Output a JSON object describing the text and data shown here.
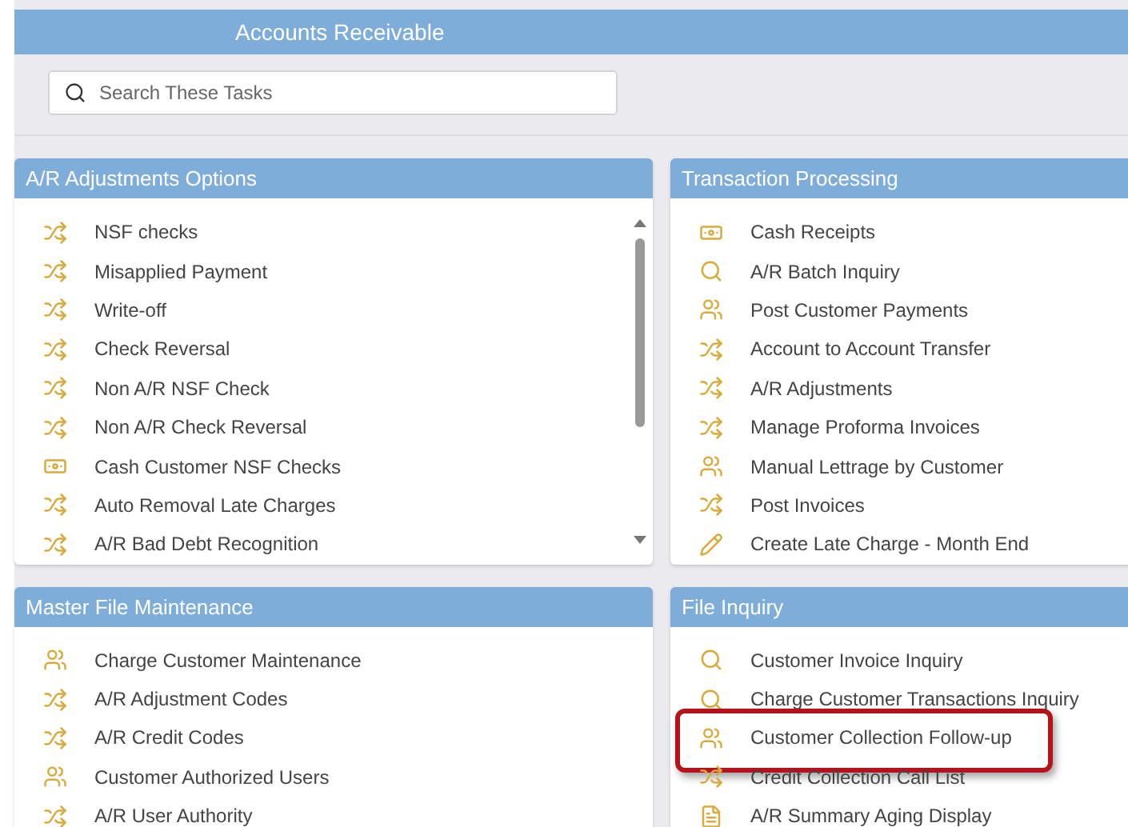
{
  "header": {
    "title": "Accounts Receivable"
  },
  "search": {
    "placeholder": "Search These Tasks"
  },
  "panels": [
    {
      "title": "A/R Adjustments Options",
      "scrollable": true,
      "items": [
        {
          "label": "NSF checks",
          "kind": "shuffle",
          "highlighted": false
        },
        {
          "label": "Misapplied Payment",
          "kind": "shuffle",
          "highlighted": false
        },
        {
          "label": "Write-off",
          "kind": "shuffle",
          "highlighted": false
        },
        {
          "label": "Check Reversal",
          "kind": "shuffle",
          "highlighted": false
        },
        {
          "label": "Non A/R NSF Check",
          "kind": "shuffle",
          "highlighted": false
        },
        {
          "label": "Non A/R Check Reversal",
          "kind": "shuffle",
          "highlighted": false
        },
        {
          "label": "Cash Customer NSF Checks",
          "kind": "cash",
          "highlighted": false
        },
        {
          "label": "Auto Removal Late Charges",
          "kind": "shuffle",
          "highlighted": false
        },
        {
          "label": "A/R Bad Debt Recognition",
          "kind": "shuffle",
          "highlighted": false
        }
      ]
    },
    {
      "title": "Transaction Processing",
      "scrollable": false,
      "items": [
        {
          "label": "Cash Receipts",
          "kind": "cash",
          "highlighted": false
        },
        {
          "label": "A/R Batch Inquiry",
          "kind": "search",
          "highlighted": false
        },
        {
          "label": "Post Customer Payments",
          "kind": "users",
          "highlighted": false
        },
        {
          "label": "Account to Account Transfer",
          "kind": "shuffle",
          "highlighted": false
        },
        {
          "label": "A/R Adjustments",
          "kind": "shuffle",
          "highlighted": false
        },
        {
          "label": "Manage Proforma Invoices",
          "kind": "shuffle",
          "highlighted": false
        },
        {
          "label": "Manual Lettrage by Customer",
          "kind": "users",
          "highlighted": false
        },
        {
          "label": "Post Invoices",
          "kind": "shuffle",
          "highlighted": false
        },
        {
          "label": "Create Late Charge - Month End",
          "kind": "pencil",
          "highlighted": false
        }
      ]
    },
    {
      "title": "Master File Maintenance",
      "scrollable": false,
      "items": [
        {
          "label": "Charge Customer Maintenance",
          "kind": "users",
          "highlighted": false
        },
        {
          "label": "A/R Adjustment Codes",
          "kind": "shuffle",
          "highlighted": false
        },
        {
          "label": "A/R Credit Codes",
          "kind": "shuffle",
          "highlighted": false
        },
        {
          "label": "Customer Authorized Users",
          "kind": "users",
          "highlighted": false
        },
        {
          "label": "A/R User Authority",
          "kind": "shuffle",
          "highlighted": false
        }
      ]
    },
    {
      "title": "File Inquiry",
      "scrollable": false,
      "items": [
        {
          "label": "Customer Invoice Inquiry",
          "kind": "search",
          "highlighted": false
        },
        {
          "label": "Charge Customer Transactions Inquiry",
          "kind": "search",
          "highlighted": false
        },
        {
          "label": "Customer Collection Follow-up",
          "kind": "users",
          "highlighted": true
        },
        {
          "label": "Credit Collection Call List",
          "kind": "shuffle",
          "highlighted": false
        },
        {
          "label": "A/R Summary Aging Display",
          "kind": "file",
          "highlighted": false
        }
      ]
    }
  ]
}
